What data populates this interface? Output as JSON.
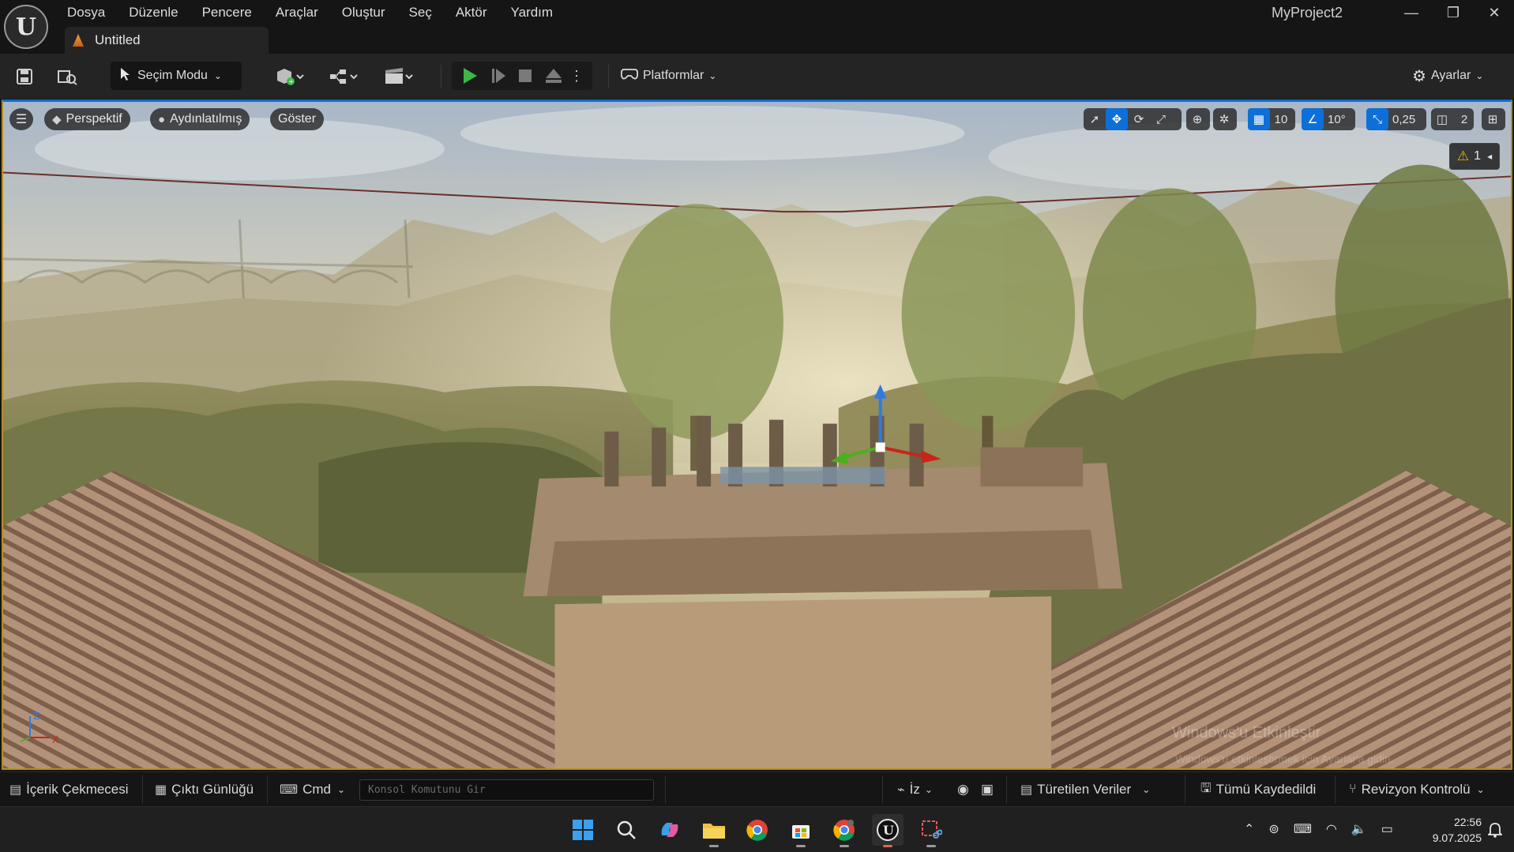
{
  "app": {
    "logo_icon": "unreal-engine-logo",
    "project_name": "MyProject2",
    "document_tab": "Untitled"
  },
  "menu": [
    "Dosya",
    "Düzenle",
    "Pencere",
    "Araçlar",
    "Oluştur",
    "Seç",
    "Aktör",
    "Yardım"
  ],
  "window_controls": {
    "minimize": "—",
    "restore": "❐",
    "close": "✕"
  },
  "toolbar": {
    "mode_label": "Seçim Modu",
    "platforms_label": "Platformlar",
    "settings_label": "Ayarlar"
  },
  "viewport": {
    "view_mode": "Perspektif",
    "lighting_mode": "Aydınlatılmış",
    "show_label": "Göster",
    "grid_snap": "10",
    "rotation_snap": "10°",
    "scale_snap": "0,25",
    "camera_speed": "2",
    "warnings_count": "1",
    "watermark_title": "Windows'u Etkinleştir",
    "watermark_sub": "Windows'u etkinleştirmek için Ayarlar'a gidin.",
    "axis_z": "Z",
    "axis_x": "X"
  },
  "statusbar": {
    "content_drawer": "İçerik Çekmecesi",
    "output_log": "Çıktı Günlüğü",
    "cmd_label": "Cmd",
    "console_placeholder": "Konsol Komutunu Gir",
    "trace_label": "İz",
    "derived_data": "Türetilen Veriler",
    "save_all": "Tümü Kaydedildi",
    "revision_control": "Revizyon Kontrolü"
  },
  "taskbar": {
    "time": "22:56",
    "date": "9.07.2025"
  },
  "colors": {
    "accent": "#0d6fd8",
    "play_green": "#3fb54a",
    "selection_border": "#b58e1f",
    "warning": "#f0b400"
  }
}
